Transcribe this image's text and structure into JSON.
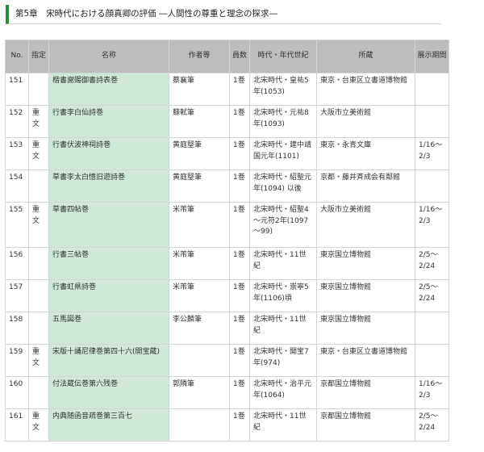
{
  "heading": "第5章　宋時代における顔真卿の評価 ―人間性の尊重と理念の探求―",
  "table": {
    "headers": {
      "no": "No.",
      "designation": "指定",
      "name": "名称",
      "author": "作者等",
      "count": "員数",
      "period": "時代・年代世紀",
      "collection": "所蔵",
      "exhibit": "展示期間"
    },
    "rows": [
      {
        "no": "151",
        "designation": "",
        "name": "楷書謝賜御書詩表巻",
        "author": "蔡襄筆",
        "count": "1巻",
        "period": "北宋時代・皇祐5年(1053)",
        "collection": "東京・台東区立書道博物館",
        "exhibit": ""
      },
      {
        "no": "152",
        "designation": "重文",
        "name": "行書李白仙詩巻",
        "author": "蘇軾筆",
        "count": "1巻",
        "period": "北宋時代・元祐8年(1093)",
        "collection": "大阪市立美術館",
        "exhibit": ""
      },
      {
        "no": "153",
        "designation": "重文",
        "name": "行書伏波神祠詩巻",
        "author": "黄庭堅筆",
        "count": "1巻",
        "period": "北宋時代・建中靖国元年(1101)",
        "collection": "東京・永青文庫",
        "exhibit": "1/16～2/3"
      },
      {
        "no": "154",
        "designation": "",
        "name": "草書李太白憶旧遊詩巻",
        "author": "黄庭堅筆",
        "count": "1巻",
        "period": "北宋時代・紹聖元年(1094) 以後",
        "collection": "京都・藤井斉成会有鄰館",
        "exhibit": ""
      },
      {
        "no": "155",
        "designation": "重文",
        "name": "草書四帖巻",
        "author": "米芾筆",
        "count": "1巻",
        "period": "北宋時代・紹聖4～元符2年(1097～99)",
        "collection": "大阪市立美術館",
        "exhibit": "1/16～2/3"
      },
      {
        "no": "156",
        "designation": "",
        "name": "行書三帖巻",
        "author": "米芾筆",
        "count": "1巻",
        "period": "北宋時代・11世紀",
        "collection": "東京国立博物館",
        "exhibit": "2/5～2/24"
      },
      {
        "no": "157",
        "designation": "",
        "name": "行書虹県詩巻",
        "author": "米芾筆",
        "count": "1巻",
        "period": "北宋時代・崇寧5年(1106)頃",
        "collection": "東京国立博物館",
        "exhibit": "2/5～2/24"
      },
      {
        "no": "158",
        "designation": "",
        "name": "五馬図巻",
        "author": "李公麟筆",
        "count": "1巻",
        "period": "北宋時代・11世紀",
        "collection": "東京国立博物館",
        "exhibit": ""
      },
      {
        "no": "159",
        "designation": "重文",
        "name": "宋版十誦尼律巻第四十六(開宝蔵)",
        "author": "",
        "count": "1巻",
        "period": "北宋時代・開宝7年(974)",
        "collection": "東京・台東区立書道博物館",
        "exhibit": ""
      },
      {
        "no": "160",
        "designation": "",
        "name": "付法蔵伝巻第六残巻",
        "author": "郭隣筆",
        "count": "1巻",
        "period": "北宋時代・治平元年(1064)",
        "collection": "京都国立博物館",
        "exhibit": "1/16～2/3"
      },
      {
        "no": "161",
        "designation": "重文",
        "name": "内典随函音疏巻第三百七",
        "author": "",
        "count": "1巻",
        "period": "北宋時代・11世紀",
        "collection": "京都国立博物館",
        "exhibit": "2/5～2/24"
      }
    ]
  }
}
